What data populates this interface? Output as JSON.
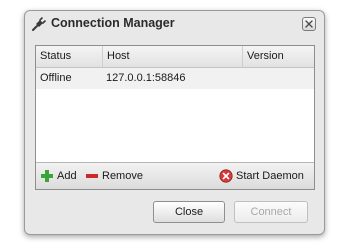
{
  "window": {
    "title": "Connection Manager",
    "title_icon": "plug-icon",
    "close_icon": "close-icon"
  },
  "table": {
    "columns": [
      "Status",
      "Host",
      "Version"
    ],
    "rows": [
      {
        "status": "Offline",
        "host": "127.0.0.1:58846",
        "version": ""
      }
    ]
  },
  "toolbar": {
    "add_label": "Add",
    "add_icon": "plus-icon",
    "remove_label": "Remove",
    "remove_icon": "minus-icon",
    "start_daemon_label": "Start Daemon",
    "start_daemon_icon": "error-x-icon"
  },
  "buttons": {
    "close_label": "Close",
    "connect_label": "Connect"
  },
  "colors": {
    "add_green": "#3aa33a",
    "remove_red": "#cc2a2a",
    "daemon_red": "#d63b3b"
  }
}
